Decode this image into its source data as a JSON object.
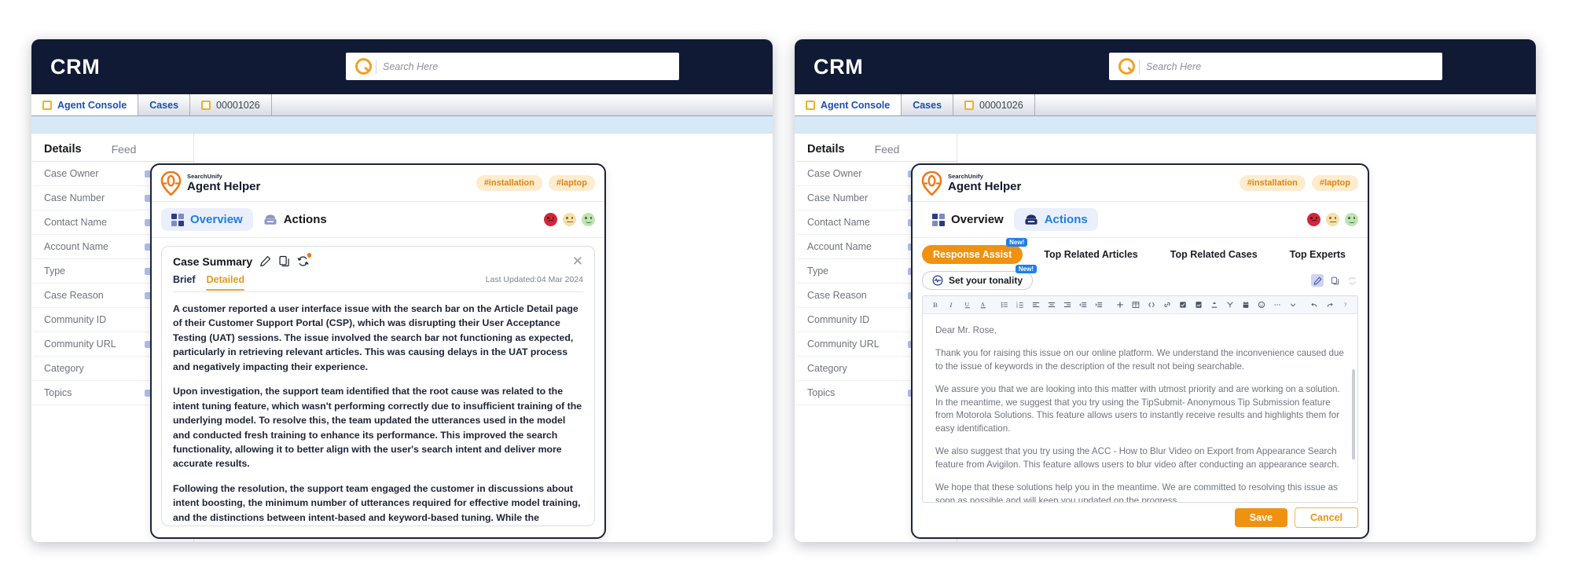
{
  "left_window": {
    "crm": {
      "logo": "CRM",
      "search_placeholder": "Search Here",
      "search_value": "",
      "search_icon": "search-icon"
    },
    "tabs": [
      {
        "label": "Agent Console",
        "has_square": true,
        "active": true
      },
      {
        "label": "Cases",
        "has_square": false,
        "active": false
      },
      {
        "label": "00001026",
        "has_square": true,
        "active": false
      }
    ],
    "details": {
      "tab_details": "Details",
      "tab_feed": "Feed",
      "fields": [
        "Case Owner",
        "Case Number",
        "Contact Name",
        "Account Name",
        "Type",
        "Case Reason",
        "Community ID",
        "Community URL",
        "Category",
        "Topics"
      ]
    },
    "helper": {
      "brand_small": "SearchUnify",
      "brand_main": "Agent Helper",
      "tags": [
        "#installation",
        "#laptop"
      ],
      "tabs": [
        {
          "label": "Overview",
          "icon": "grid-icon",
          "active": true
        },
        {
          "label": "Actions",
          "icon": "actions-icon",
          "active": false
        }
      ],
      "sentiments": [
        "sad-face-icon",
        "neutral-face-icon",
        "happy-face-icon"
      ],
      "summary": {
        "title": "Case Summary",
        "icons": [
          "edit-icon",
          "copy-icon",
          "refresh-icon"
        ],
        "close": "✕",
        "tabs": [
          {
            "label": "Brief",
            "active": false
          },
          {
            "label": "Detailed",
            "active": true
          }
        ],
        "last_updated": "Last Updated:04 Mar 2024",
        "paragraphs": [
          "A customer reported a user interface issue with the search bar on the Article Detail page of their Customer Support Portal (CSP), which was disrupting their User Acceptance Testing (UAT) sessions. The issue involved the search bar not functioning as expected, particularly in retrieving relevant articles. This was causing delays in the UAT process and negatively impacting their experience.",
          "Upon investigation, the support team identified that the root cause was related to the intent tuning feature, which wasn't performing correctly due to insufficient training of the underlying model. To resolve this, the team updated the utterances used in the model and conducted fresh training to enhance its performance. This improved the search functionality, allowing it to better align with the user's search intent and deliver more accurate results.",
          "Following the resolution, the support team engaged the customer in discussions about intent boosting, the minimum number of utterances required for effective model training, and the distinctions between intent-based and keyword-based tuning. While the immediate issue has been resolved, the customer is now awaiting further information on the broader functionality of intent tuning and the machine learning (ML) engine behind it to ensure smooth operations going forward."
        ]
      }
    }
  },
  "right_window": {
    "crm": {
      "logo": "CRM",
      "search_placeholder": "Search Here",
      "search_value": "",
      "search_icon": "search-icon"
    },
    "tabs": [
      {
        "label": "Agent Console",
        "has_square": true,
        "active": true
      },
      {
        "label": "Cases",
        "has_square": false,
        "active": false
      },
      {
        "label": "00001026",
        "has_square": true,
        "active": false
      }
    ],
    "details": {
      "tab_details": "Details",
      "tab_feed": "Feed",
      "fields": [
        "Case Owner",
        "Case Number",
        "Contact Name",
        "Account Name",
        "Type",
        "Case Reason",
        "Community ID",
        "Community URL",
        "Category",
        "Topics"
      ]
    },
    "helper": {
      "brand_small": "SearchUnify",
      "brand_main": "Agent Helper",
      "tags": [
        "#installation",
        "#laptop"
      ],
      "tabs": [
        {
          "label": "Overview",
          "icon": "grid-icon",
          "active": false
        },
        {
          "label": "Actions",
          "icon": "actions-icon",
          "active": true
        }
      ],
      "sentiments": [
        "sad-face-icon",
        "neutral-face-icon",
        "happy-face-icon"
      ],
      "actions": {
        "tabs": [
          {
            "label": "Response Assist",
            "active": true,
            "badge": "New!"
          },
          {
            "label": "Top Related Articles",
            "active": false,
            "badge": ""
          },
          {
            "label": "Top Related Cases",
            "active": false,
            "badge": ""
          },
          {
            "label": "Top Experts",
            "active": false,
            "badge": ""
          }
        ],
        "tonality": {
          "label": "Set your tonality",
          "badge": "New!",
          "icon": "tonality-icon"
        },
        "right_icons": [
          "edit-icon",
          "copy-icon",
          "refresh-icon"
        ],
        "toolbar": [
          "bold-icon",
          "italic-icon",
          "underline-icon",
          "text-color-icon",
          "bullet-list-icon",
          "numbered-list-icon",
          "align-left-icon",
          "align-center-icon",
          "align-right-icon",
          "outdent-icon",
          "indent-icon",
          "insert-icon",
          "table-icon",
          "code-icon",
          "link-icon",
          "checkbox-icon",
          "image-icon",
          "attachment-icon",
          "merge-field-icon",
          "calendar-icon",
          "emoji-icon",
          "more-icon",
          "chevron-down-icon",
          "undo-icon",
          "redo-icon",
          "help-icon"
        ],
        "email_paragraphs": [
          "Dear Mr. Rose,",
          "Thank you for raising this issue on our online platform. We understand the inconvenience caused due to the issue of keywords in the description of the result not being searchable.",
          "We assure you that we are looking into this matter with utmost priority and are working on a solution. In the meantime, we suggest that you try using the TipSubmit- Anonymous Tip Submission feature from Motorola Solutions. This feature allows users to instantly receive results and highlights them for easy identification.",
          "We also suggest that you try using the ACC - How to Blur Video on Export from Appearance Search feature from Avigilon. This feature allows users to blur video after conducting an appearance search.",
          "We hope that these solutions help you in the meantime. We are committed to resolving this issue as soon as possible and will keep you updated on the progress."
        ],
        "save_label": "Save",
        "cancel_label": "Cancel"
      }
    }
  },
  "colors": {
    "navy": "#111a34",
    "orange": "#f0920f",
    "blue": "#1b7fe0",
    "tag_bg": "#fdeccd",
    "tag_fg": "#e08512",
    "badge_blue": "#1f7fe8"
  }
}
